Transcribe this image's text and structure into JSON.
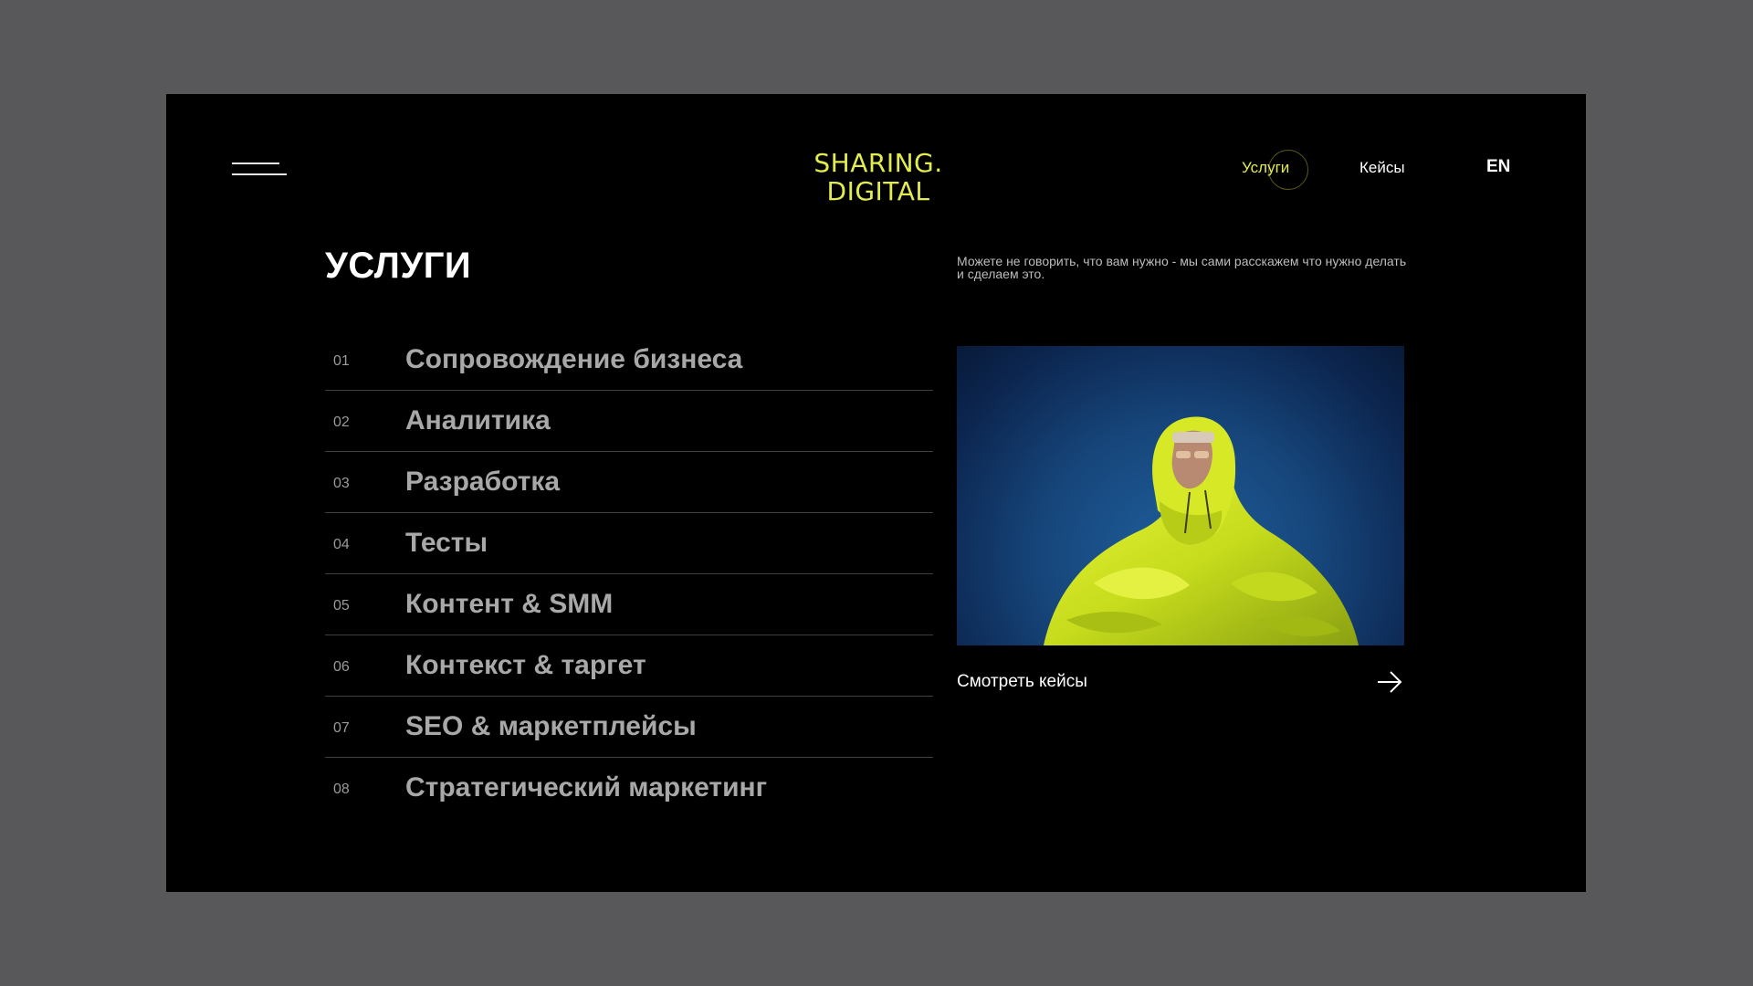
{
  "header": {
    "logo_line1": "SHARING.",
    "logo_line2": "DIGITAL",
    "nav": {
      "services": "Услуги",
      "cases": "Кейсы",
      "lang": "EN"
    }
  },
  "main": {
    "title": "УСЛУГИ",
    "description": "Можете не говорить, что вам нужно - мы сами расскажем что нужно делать и сделаем это.",
    "services": [
      {
        "num": "01",
        "label": "Сопровождение бизнеса"
      },
      {
        "num": "02",
        "label": "Аналитика"
      },
      {
        "num": "03",
        "label": "Разработка"
      },
      {
        "num": "04",
        "label": "Тесты"
      },
      {
        "num": "05",
        "label": "Контент & SMM"
      },
      {
        "num": "06",
        "label": "Контекст & таргет"
      },
      {
        "num": "07",
        "label": "SEO & маркетплейсы"
      },
      {
        "num": "08",
        "label": "Стратегический маркетинг"
      }
    ],
    "cases_link": "Смотреть кейсы"
  },
  "icons": {
    "menu": "menu-icon",
    "arrow": "arrow-right-icon"
  },
  "colors": {
    "outer_background": "#58585a",
    "page_background": "#000000",
    "accent": "#e3ec4f",
    "text": "#ffffff",
    "muted_text": "#a8a8a8",
    "divider": "#3f3f3f"
  }
}
